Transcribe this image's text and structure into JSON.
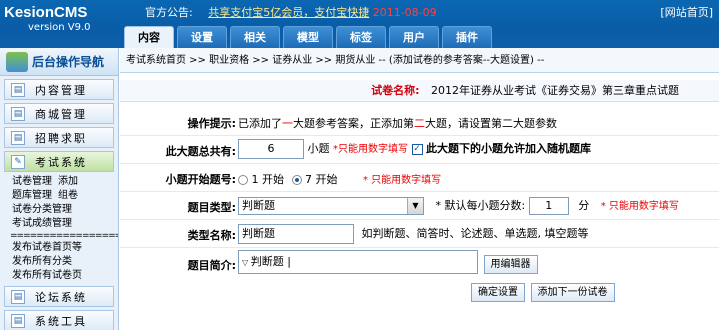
{
  "header": {
    "logo_name": "KesionCMS",
    "logo_version": "version V9.0",
    "notice_label": "官方公告:",
    "notice_link": "共享支付宝5亿会员，支付宝快捷",
    "notice_date": "2011-08-09",
    "site_home": "[网站首页]",
    "tabs": [
      "内容",
      "设置",
      "相关",
      "模型",
      "标签",
      "用户",
      "插件"
    ],
    "active_tab": "内容"
  },
  "sidebar": {
    "title": "后台操作导航",
    "groups_top": [
      "内容管理",
      "商城管理",
      "招聘求职"
    ],
    "open_group": "考试系统",
    "items": [
      {
        "label": "试卷管理",
        "extra": "添加"
      },
      {
        "label": "题库管理",
        "extra": "组卷"
      },
      {
        "label": "试卷分类管理",
        "extra": ""
      },
      {
        "label": "考试成绩管理",
        "extra": ""
      }
    ],
    "separator": "==================",
    "publish_items": [
      "发布试卷首页等",
      "发布所有分类",
      "发布所有试卷页"
    ],
    "groups_bottom": [
      "论坛系统",
      "系统工具"
    ]
  },
  "breadcrumb": "考试系统首页 >> 职业资格 >> 证券从业 >> 期货从业 -- (添加试卷的参考答案--大题设置) --",
  "paper": {
    "label": "试卷名称:",
    "name": "2012年证券从业考试《证券交易》第三章重点试题"
  },
  "form": {
    "tip_label": "操作提示:",
    "tip_a": "已添加了",
    "tip_b": "一",
    "tip_c": "大题参考答案，正添加第",
    "tip_d": "二",
    "tip_e": "大题，请设置第二大题参数",
    "count_label": "此大题总共有:",
    "count_value": "6",
    "count_unit": "小题",
    "count_hint": "*只能用数字填写",
    "allow_random_label": "此大题下的小题允许加入随机题库",
    "start_label": "小题开始题号:",
    "start_opt1": "1 开始",
    "start_opt2": "7 开始",
    "start_hint": "* 只能用数字填写",
    "type_label": "题目类型:",
    "type_value": "判断题",
    "score_label": "* 默认每小题分数:",
    "score_value": "1",
    "score_unit": "分",
    "score_hint": "* 只能用数字填写",
    "typename_label": "类型名称:",
    "typename_value": "判断题",
    "typename_hint": "如判断题、简答时、论述题、单选题, 填空题等",
    "intro_label": "题目简介:",
    "intro_value": "判断题",
    "editor_btn": "用编辑器",
    "confirm_btn": "确定设置",
    "next_btn": "添加下一份试卷"
  }
}
